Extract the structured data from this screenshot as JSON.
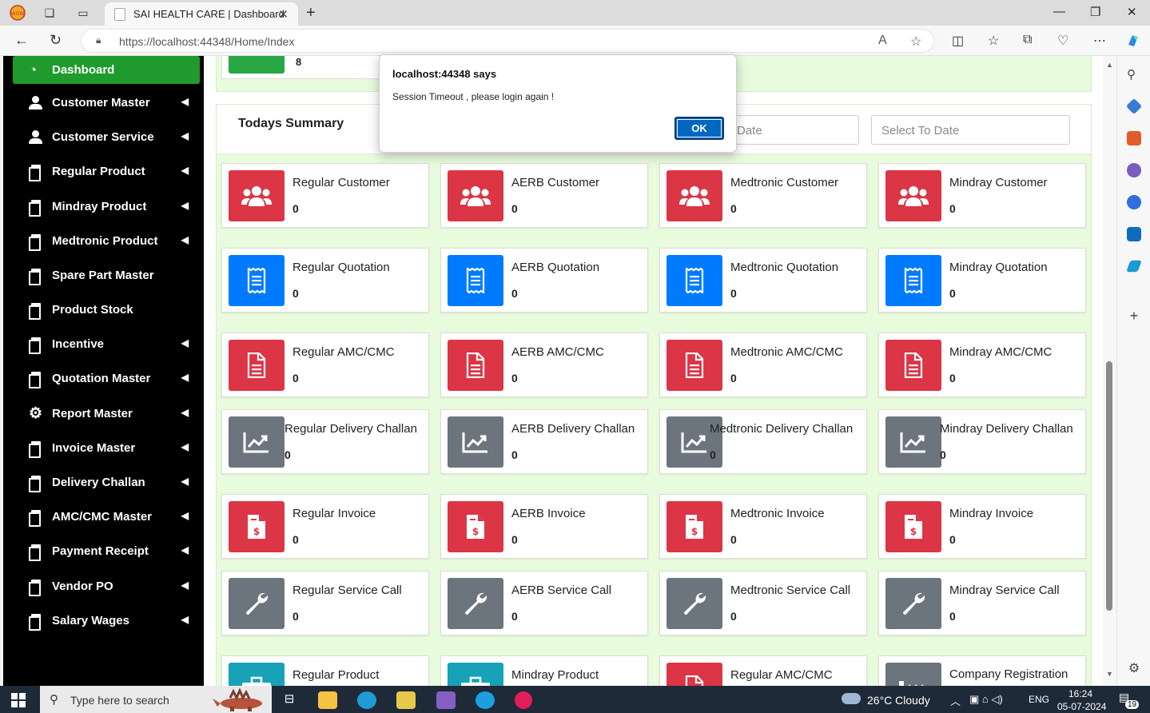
{
  "browser": {
    "tab_title": "SAI HEALTH CARE | Dashboard",
    "url": "https://localhost:44348/Home/Index"
  },
  "sidebar": {
    "items": [
      {
        "label": "Dashboard",
        "icon": "dashboard-icon",
        "active": true,
        "chevron": false
      },
      {
        "label": "Customer Master",
        "icon": "user-icon",
        "chevron": true
      },
      {
        "label": "Customer Service",
        "icon": "user-icon",
        "chevron": true
      },
      {
        "label": "Regular Product",
        "icon": "copy-icon",
        "chevron": true
      },
      {
        "label": "Mindray Product",
        "icon": "copy-icon",
        "chevron": true
      },
      {
        "label": "Medtronic Product",
        "icon": "copy-icon",
        "chevron": true
      },
      {
        "label": "Spare Part Master",
        "icon": "copy-icon",
        "chevron": false
      },
      {
        "label": "Product Stock",
        "icon": "copy-icon",
        "chevron": false
      },
      {
        "label": "Incentive",
        "icon": "copy-icon",
        "chevron": true
      },
      {
        "label": "Quotation Master",
        "icon": "copy-icon",
        "chevron": true
      },
      {
        "label": "Report Master",
        "icon": "gear-icon",
        "chevron": true
      },
      {
        "label": "Invoice Master",
        "icon": "copy-icon",
        "chevron": true
      },
      {
        "label": "Delivery Challan",
        "icon": "copy-icon",
        "chevron": true
      },
      {
        "label": "AMC/CMC Master",
        "icon": "copy-icon",
        "chevron": true
      },
      {
        "label": "Payment Receipt",
        "icon": "copy-icon",
        "chevron": true
      },
      {
        "label": "Vendor PO",
        "icon": "copy-icon",
        "chevron": true
      },
      {
        "label": "Salary Wages",
        "icon": "copy-icon",
        "chevron": true
      }
    ]
  },
  "top_card": {
    "value": "8"
  },
  "summary": {
    "title": "Todays Summary",
    "from_date_placeholder": "Date",
    "to_date_placeholder": "Select To Date"
  },
  "cards": [
    {
      "label": "Regular Customer",
      "value": "0",
      "color": "red",
      "icon": "users-icon"
    },
    {
      "label": "AERB Customer",
      "value": "0",
      "color": "red",
      "icon": "users-icon"
    },
    {
      "label": "Medtronic Customer",
      "value": "0",
      "color": "red",
      "icon": "users-icon"
    },
    {
      "label": "Mindray Customer",
      "value": "0",
      "color": "red",
      "icon": "users-icon"
    },
    {
      "label": "Regular Quotation",
      "value": "0",
      "color": "blue",
      "icon": "receipt-icon"
    },
    {
      "label": "AERB Quotation",
      "value": "0",
      "color": "blue",
      "icon": "receipt-icon"
    },
    {
      "label": "Medtronic Quotation",
      "value": "0",
      "color": "blue",
      "icon": "receipt-icon"
    },
    {
      "label": "Mindray Quotation",
      "value": "0",
      "color": "blue",
      "icon": "receipt-icon"
    },
    {
      "label": "Regular AMC/CMC",
      "value": "0",
      "color": "red",
      "icon": "file-alt-icon"
    },
    {
      "label": "AERB AMC/CMC",
      "value": "0",
      "color": "red",
      "icon": "file-alt-icon"
    },
    {
      "label": "Medtronic AMC/CMC",
      "value": "0",
      "color": "red",
      "icon": "file-alt-icon"
    },
    {
      "label": "Mindray AMC/CMC",
      "value": "0",
      "color": "red",
      "icon": "file-alt-icon"
    },
    {
      "label": "Regular Delivery Challan",
      "value": "0",
      "color": "gray",
      "icon": "chart-line-icon"
    },
    {
      "label": "AERB Delivery Challan",
      "value": "0",
      "color": "gray",
      "icon": "chart-line-icon"
    },
    {
      "label": "Medtronic Delivery Challan",
      "value": "0",
      "color": "gray",
      "icon": "chart-line-icon"
    },
    {
      "label": "Mindray Delivery Challan",
      "value": "0",
      "color": "gray",
      "icon": "chart-line-icon"
    },
    {
      "label": "Regular Invoice",
      "value": "0",
      "color": "red",
      "icon": "invoice-dollar-icon"
    },
    {
      "label": "AERB Invoice",
      "value": "0",
      "color": "red",
      "icon": "invoice-dollar-icon"
    },
    {
      "label": "Medtronic Invoice",
      "value": "0",
      "color": "red",
      "icon": "invoice-dollar-icon"
    },
    {
      "label": "Mindray Invoice",
      "value": "0",
      "color": "red",
      "icon": "invoice-dollar-icon"
    },
    {
      "label": "Regular Service Call",
      "value": "0",
      "color": "gray",
      "icon": "wrench-icon"
    },
    {
      "label": "AERB Service Call",
      "value": "0",
      "color": "gray",
      "icon": "wrench-icon"
    },
    {
      "label": "Medtronic Service Call",
      "value": "0",
      "color": "gray",
      "icon": "wrench-icon"
    },
    {
      "label": "Mindray Service Call",
      "value": "0",
      "color": "gray",
      "icon": "wrench-icon"
    },
    {
      "label": "Regular Product",
      "value": "",
      "color": "teal",
      "icon": "medkit-icon"
    },
    {
      "label": "Mindray Product",
      "value": "",
      "color": "teal",
      "icon": "medkit-icon"
    },
    {
      "label": "Regular AMC/CMC",
      "value": "",
      "color": "red",
      "icon": "file-alt-icon"
    },
    {
      "label": "Company Registration",
      "value": "",
      "color": "gray",
      "icon": "industry-icon"
    }
  ],
  "dialog": {
    "title": "localhost:44348 says",
    "message": "Session Timeout , please login again !",
    "ok_label": "OK"
  },
  "taskbar": {
    "search_placeholder": "Type here to search",
    "weather": "26°C  Cloudy",
    "language": "ENG",
    "time": "16:24",
    "date": "05-07-2024",
    "notification_count": "19"
  },
  "colors": {
    "red": "#dc3545",
    "blue": "#007bff",
    "gray": "#6c757d",
    "teal": "#17a2b8",
    "active_green": "#1e9b2c",
    "panel_green": "#e8fbdc"
  }
}
